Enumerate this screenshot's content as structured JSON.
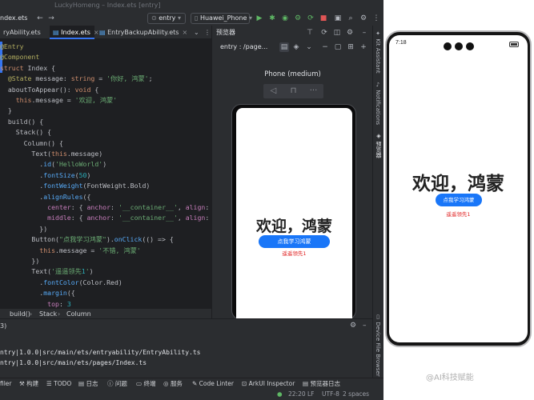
{
  "window": {
    "title": "LuckyHomeng – Index.ets [entry]"
  },
  "toolbar": {
    "file_label": "ndex.ets",
    "module_combo": "entry",
    "device_combo": "Huawei_Phone",
    "colors": {
      "run": "#5fb865",
      "debug": "#5fb865",
      "stop": "#e05555"
    }
  },
  "tabs": [
    {
      "label": "ryAbility.ets",
      "active": false
    },
    {
      "label": "Index.ets",
      "active": true
    },
    {
      "label": "EntryBackupAbility.ets",
      "active": false
    }
  ],
  "code": [
    "@Entry",
    "@Component",
    "struct Index {",
    "  @State message: string = '你好, 鸿蒙';",
    "  aboutToAppear(): void {",
    "    this.message = '欢迎, 鸿蒙'",
    "  }",
    "  build() {",
    "    Stack() {",
    "      Column() {",
    "        Text(this.message)",
    "          .id('HelloWorld')",
    "          .fontSize(50)",
    "          .fontWeight(FontWeight.Bold)",
    "          .alignRules({",
    "            center: { anchor: '__container__', align:",
    "            middle: { anchor: '__container__', align:",
    "          })",
    "        Button(\"点我学习鸿蒙\").onClick(() => {",
    "          this.message = '不错, 鸿蒙'",
    "        })",
    "        Text('遥遥领先1')",
    "          .fontColor(Color.Red)",
    "          .margin({",
    "            top: 3"
  ],
  "breadcrumb": [
    "build()",
    "Stack",
    "Column"
  ],
  "previewer": {
    "title": "预览器",
    "entry_label": "entry : /page...",
    "device_label": "Phone (medium)",
    "screen": {
      "headline": "欢迎，鸿蒙",
      "button_label": "点我学习鸿蒙",
      "red_text": "遥遥领先1"
    }
  },
  "side_tools": [
    "Kit Assistant",
    "Notifications",
    "预览器",
    "Device File Browser"
  ],
  "bottom_panel": {
    "header": "3)",
    "lines": [
      "ntry|1.0.0|src/main/ets/entryability/EntryAbility.ts",
      "ntry|1.0.0|src/main/ets/pages/Index.ts"
    ]
  },
  "tool_tabs": [
    "filer",
    "构建",
    "TODO",
    "日志",
    "问题",
    "终端",
    "服务",
    "Code Linter",
    "ArkUI Inspector",
    "预览器日志"
  ],
  "status": {
    "time": "22:20",
    "line_sep": "LF",
    "encoding": "UTF-8",
    "indent": "2 spaces"
  },
  "phone": {
    "time": "7:18",
    "headline": "欢迎，鸿蒙",
    "button_label": "点我学习鸿蒙",
    "red_text": "遥遥领先1"
  },
  "watermark": "@AI科技赋能"
}
